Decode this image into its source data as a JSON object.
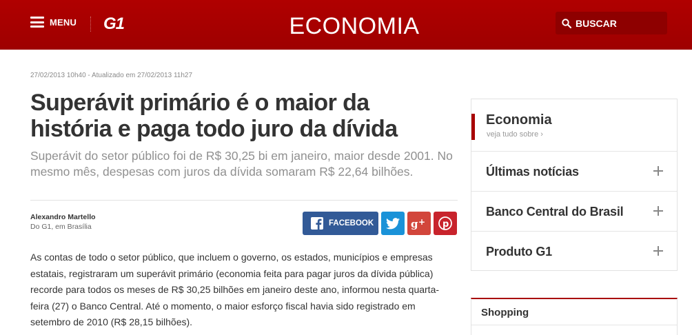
{
  "header": {
    "menu_label": "MENU",
    "logo": "G1",
    "section_title": "ECONOMIA",
    "search_label": "BUSCAR",
    "background_color": "#a80000"
  },
  "article": {
    "meta": "27/02/2013 10h40 - Atualizado em 27/02/2013 11h27",
    "headline": "Superávit primário é o maior da história e paga todo juro da dívida",
    "subhead": "Superávit do setor público foi de R$ 30,25 bi em janeiro, maior desde 2001. No mesmo mês, despesas com juros da dívida somaram R$ 22,64 bilhões.",
    "author": "Alexandro Martello",
    "author_location": "Do G1, em Brasília",
    "body": "As contas de todo o setor público, que incluem o governo, os estados, municípios e empresas estatais, registraram um superávit primário (economia feita para pagar juros da dívida pública) recorde para todos os meses de R$ 30,25 bilhões em janeiro deste ano, informou nesta quarta-feira (27) o Banco Central. Até o momento, o maior esforço fiscal havia sido registrado em setembro de 2010 (R$ 28,15 bilhões)."
  },
  "share": {
    "facebook_label": "FACEBOOK",
    "icons": [
      "facebook-icon",
      "twitter-icon",
      "google-plus-icon",
      "pinterest-icon"
    ],
    "colors": {
      "facebook": "#325a97",
      "twitter": "#1a92d8",
      "google_plus": "#d2463b",
      "pinterest": "#c8232c"
    }
  },
  "sidebar": {
    "title": "Economia",
    "see_all": "veja tudo sobre ›",
    "items": [
      {
        "label": "Últimas notícias"
      },
      {
        "label": "Banco Central do Brasil"
      },
      {
        "label": "Produto G1"
      }
    ]
  },
  "shopping": {
    "title": "Shopping"
  }
}
